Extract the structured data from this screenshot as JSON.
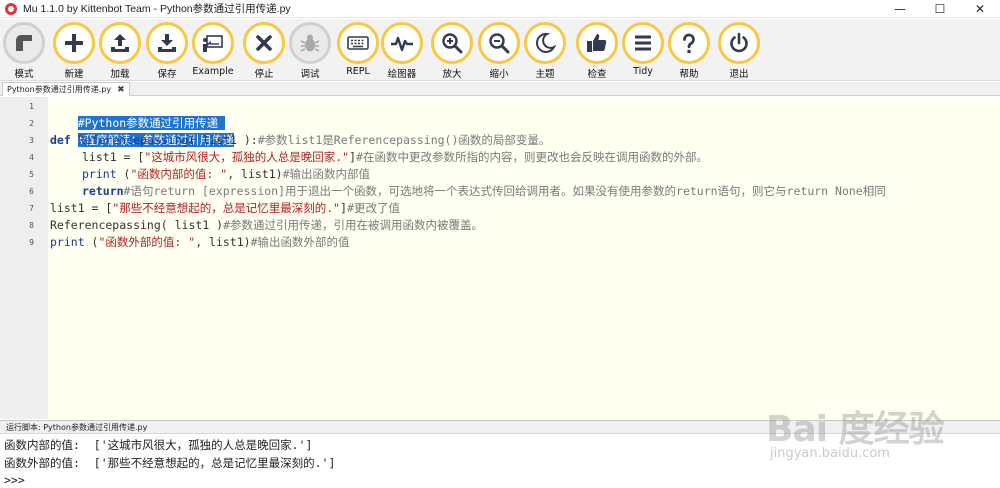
{
  "window": {
    "title": "Mu 1.1.0 by Kittenbot Team - Python参数通过引用传递.py",
    "minimize": "—",
    "maximize": "☐",
    "close": "✕"
  },
  "toolbar": [
    {
      "id": "mode",
      "label": "模式",
      "icon": "mode-icon",
      "enabled": true
    },
    {
      "id": "new",
      "label": "新建",
      "icon": "plus-icon",
      "enabled": true
    },
    {
      "id": "load",
      "label": "加载",
      "icon": "upload-icon",
      "enabled": true
    },
    {
      "id": "save",
      "label": "保存",
      "icon": "download-icon",
      "enabled": true
    },
    {
      "id": "example",
      "label": "Example",
      "icon": "presentation-icon",
      "enabled": true
    },
    {
      "id": "stop",
      "label": "停止",
      "icon": "close-icon",
      "enabled": true
    },
    {
      "id": "debug",
      "label": "调试",
      "icon": "bug-icon",
      "enabled": false
    },
    {
      "id": "repl",
      "label": "REPL",
      "icon": "keyboard-icon",
      "enabled": true
    },
    {
      "id": "plotter",
      "label": "绘图器",
      "icon": "pulse-icon",
      "enabled": true
    },
    {
      "id": "zoom-in",
      "label": "放大",
      "icon": "zoom-in-icon",
      "enabled": true
    },
    {
      "id": "zoom-out",
      "label": "缩小",
      "icon": "zoom-out-icon",
      "enabled": true
    },
    {
      "id": "theme",
      "label": "主题",
      "icon": "moon-icon",
      "enabled": true
    },
    {
      "id": "check",
      "label": "检查",
      "icon": "thumbs-up-icon",
      "enabled": true
    },
    {
      "id": "tidy",
      "label": "Tidy",
      "icon": "lines-icon",
      "enabled": true
    },
    {
      "id": "help",
      "label": "帮助",
      "icon": "question-icon",
      "enabled": true
    },
    {
      "id": "quit",
      "label": "退出",
      "icon": "power-icon",
      "enabled": true
    }
  ],
  "tab": {
    "label": "Python参数通过引用传递.py",
    "close": "✖"
  },
  "editor": {
    "line_numbers": [
      "1",
      "2",
      "3",
      "4",
      "5",
      "6",
      "7",
      "8",
      "9"
    ],
    "lines": {
      "l1": {
        "comment": "#Python参数通过引用传递 "
      },
      "l2": {
        "comment": "#程序解读：参数通过引用传递"
      },
      "l3": {
        "kw": "def",
        "name": " Referencepassing",
        "rest": "( list1 ):",
        "comment": "#参数list1是Referencepassing()函数的局部变量。"
      },
      "l4": {
        "code": "list1 = [",
        "str": "\"这城市风很大，孤独的人总是晚回家.\"",
        "code2": "]",
        "comment": "#在函数中更改参数所指的内容，则更改也会反映在调用函数的外部。"
      },
      "l5": {
        "fn": "print",
        "code": " (",
        "str": "\"函数内部的值: \"",
        "code2": ", list1)",
        "comment": "#输出函数内部值"
      },
      "l6": {
        "kw": "return",
        "comment": "#语句return [expression]用于退出一个函数，可选地将一个表达式传回给调用者。如果没有使用参数的return语句，则它与return None相同"
      },
      "l7": {
        "code": "list1 = [",
        "str": "\"那些不经意想起的，总是记忆里最深刻的.\"",
        "code2": "]",
        "comment": "#更改了值"
      },
      "l8": {
        "code": "Referencepassing( list1 )",
        "comment": "#参数通过引用传递，引用在被调用函数内被覆盖。"
      },
      "l9": {
        "fn": "print",
        "code": " (",
        "str": "\"函数外部的值: \"",
        "code2": ", list1)",
        "comment": "#输出函数外部的值"
      }
    }
  },
  "output": {
    "header": "运行脚本: Python参数通过引用传递.py",
    "lines": [
      "函数内部的值:  ['这城市风很大，孤独的人总是晚回家.']",
      "函数外部的值:  ['那些不经意想起的，总是记忆里最深刻的.']",
      ">>>"
    ]
  },
  "watermark": {
    "logo": "Bai 度经验",
    "url": "jingyan.baidu.com"
  },
  "colors": {
    "button_ring": "#f7c844",
    "selection": "#1e74d0",
    "editor_bg": "#fffff2",
    "keyword": "#1c3b9a",
    "string": "#b22222",
    "comment": "#7a7a7a"
  }
}
